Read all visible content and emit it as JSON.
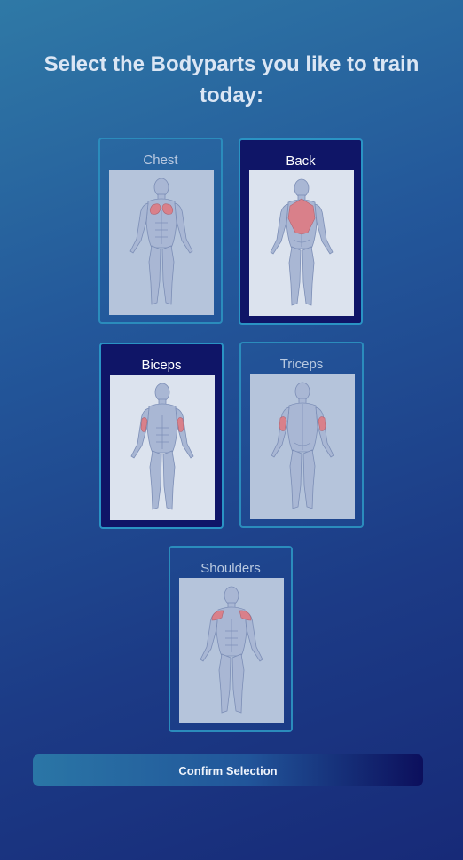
{
  "title": "Select the Bodyparts you like to train today:",
  "cards": [
    {
      "label": "Chest",
      "selected": false,
      "view": "front",
      "highlight": "chest"
    },
    {
      "label": "Back",
      "selected": true,
      "view": "back",
      "highlight": "back"
    },
    {
      "label": "Biceps",
      "selected": true,
      "view": "front",
      "highlight": "biceps"
    },
    {
      "label": "Triceps",
      "selected": false,
      "view": "back",
      "highlight": "triceps"
    },
    {
      "label": "Shoulders",
      "selected": false,
      "view": "front",
      "highlight": "shoulders"
    }
  ],
  "confirm_label": "Confirm Selection",
  "colors": {
    "selected_card": "#0f1567",
    "card_border": "#2b8cbc",
    "muscle_highlight": "#d9808a"
  }
}
